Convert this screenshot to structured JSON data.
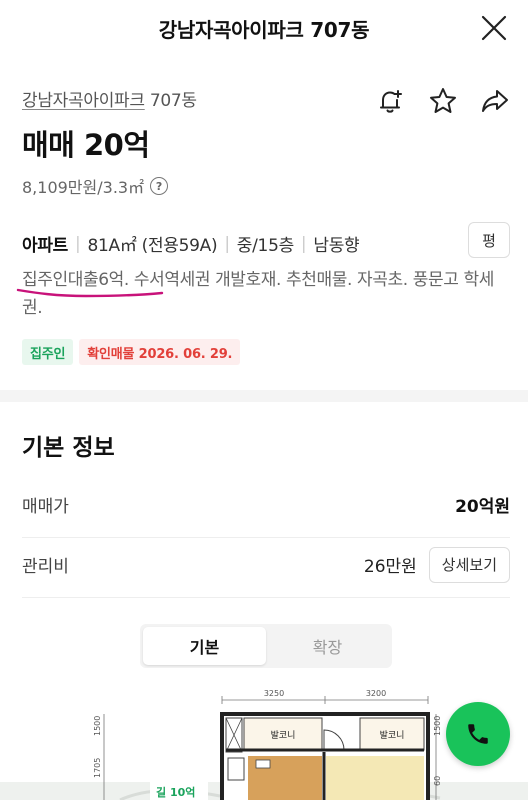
{
  "header": {
    "title": "강남자곡아이파크 707동"
  },
  "summary": {
    "complex_name": "강남자곡아이파크",
    "building": "707동",
    "price": "매매 20억",
    "unit_price": "8,109만원/3.3㎡",
    "help_glyph": "?"
  },
  "spec": {
    "type": "아파트",
    "area": "81A㎡ (전용59A)",
    "floor": "중/15층",
    "direction": "남동향",
    "sep": "|",
    "pyeong_label": "평"
  },
  "description": "집주인대출6억. 수서역세권 개발호재. 추천매물. 자곡초. 풍문고 학세권.",
  "badges": {
    "owner": "집주인",
    "confirmed": "확인매물 2026. 06. 29."
  },
  "basic_info": {
    "title": "기본 정보",
    "sale_label": "매매가",
    "sale_value": "20억원",
    "fee_label": "관리비",
    "fee_value": "26만원",
    "detail_button": "상세보기"
  },
  "tabs": [
    {
      "label": "기본",
      "active": true
    },
    {
      "label": "확장",
      "active": false
    }
  ],
  "floor_plan": {
    "dim_left": "3250",
    "dim_right": "3200",
    "dim_v1": "1500",
    "dim_v2": "1705",
    "dim_v3": "1500",
    "dim_v4": "60",
    "room_left": "발코니",
    "room_right": "발코니",
    "map_label": "길 10억"
  },
  "colors": {
    "accent_green": "#19c35a",
    "badge_red": "#e2403a",
    "highlight_stroke": "#c8127a"
  }
}
